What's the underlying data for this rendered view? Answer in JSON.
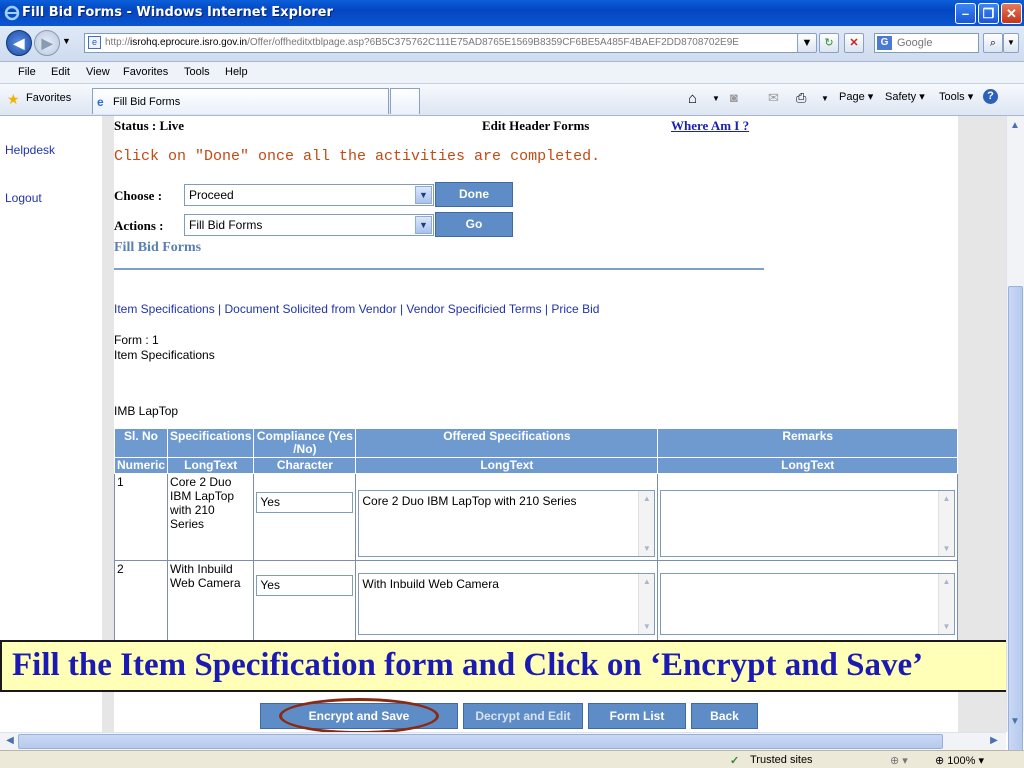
{
  "window": {
    "title": "Fill Bid Forms - Windows Internet Explorer"
  },
  "address": {
    "url_prefix": "http://",
    "url_host": "isrohq.eprocure.isro.gov.in",
    "url_path": "/Offer/offheditxtblpage.asp?6B5C375762C111E75AD8765E1569B8359CF6BE5A485F4BAEF2DD8708702E9E",
    "search_placeholder": "Google"
  },
  "menu": [
    "File",
    "Edit",
    "View",
    "Favorites",
    "Tools",
    "Help"
  ],
  "favorites_label": "Favorites",
  "tab_label": "Fill Bid Forms",
  "commands": {
    "page": "Page",
    "safety": "Safety",
    "tools": "Tools"
  },
  "sidebar": {
    "helpdesk": "Helpdesk",
    "logout": "Logout"
  },
  "header": {
    "status": "Status : Live",
    "edit_header": "Edit Header Forms",
    "where_am_i": "Where Am I ?",
    "done_message": "Click on \"Done\" once all the activities are completed."
  },
  "choose": {
    "label": "Choose :",
    "value": "Proceed",
    "button": "Done"
  },
  "actions": {
    "label": "Actions :",
    "value": "Fill Bid Forms",
    "button": "Go"
  },
  "section_title": "Fill Bid Forms",
  "form_links": [
    "Item Specifications",
    "Document Solicited from Vendor",
    "Vendor Specificied Terms",
    "Price Bid"
  ],
  "form": {
    "number_label": "Form : 1",
    "name": "Item Specifications",
    "item": "IMB LapTop"
  },
  "table": {
    "headers": [
      "Sl. No",
      "Specifications",
      "Compliance (Yes /No)",
      "Offered Specifications",
      "Remarks"
    ],
    "subheaders": [
      "Numeric",
      "LongText",
      "Character",
      "LongText",
      "LongText"
    ],
    "rows": [
      {
        "sl": "1",
        "spec": "Core 2 Duo IBM LapTop with 210 Series",
        "compliance": "Yes",
        "offered": "Core 2 Duo IBM LapTop with 210 Series",
        "remarks": ""
      },
      {
        "sl": "2",
        "spec": "With Inbuild Web Camera",
        "compliance": "Yes",
        "offered": "With Inbuild Web Camera",
        "remarks": ""
      }
    ]
  },
  "banner": "Fill the Item Specification form and Click on ‘Encrypt and Save’",
  "bottom_buttons": {
    "encrypt": "Encrypt and Save",
    "decrypt": "Decrypt and Edit",
    "form_list": "Form List",
    "back": "Back"
  },
  "statusbar": {
    "zone": "Trusted sites",
    "zoom": "100%"
  },
  "colors": {
    "accent_blue": "#5e8cc6",
    "banner_bg": "#ffffb8",
    "banner_text": "#1b1bb3",
    "message_orange": "#c24a14",
    "ellipse": "#8b2a12"
  }
}
